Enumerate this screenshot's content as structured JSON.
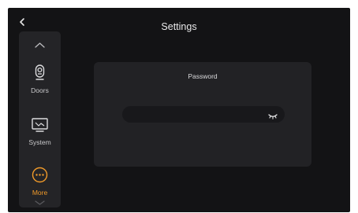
{
  "header": {
    "title": "Settings"
  },
  "sidebar": {
    "items": [
      {
        "label": "Doors",
        "icon": "intercom-camera-icon",
        "active": false
      },
      {
        "label": "System",
        "icon": "monitor-icon",
        "active": false
      },
      {
        "label": "More",
        "icon": "more-dots-icon",
        "active": true
      }
    ]
  },
  "panel": {
    "title": "Password",
    "password_value": "",
    "password_placeholder": ""
  },
  "colors": {
    "background": "#131315",
    "sidebar": "#242427",
    "panel": "#222225",
    "field": "#18181b",
    "accent": "#f09a2a",
    "text": "#e9e9ea"
  }
}
